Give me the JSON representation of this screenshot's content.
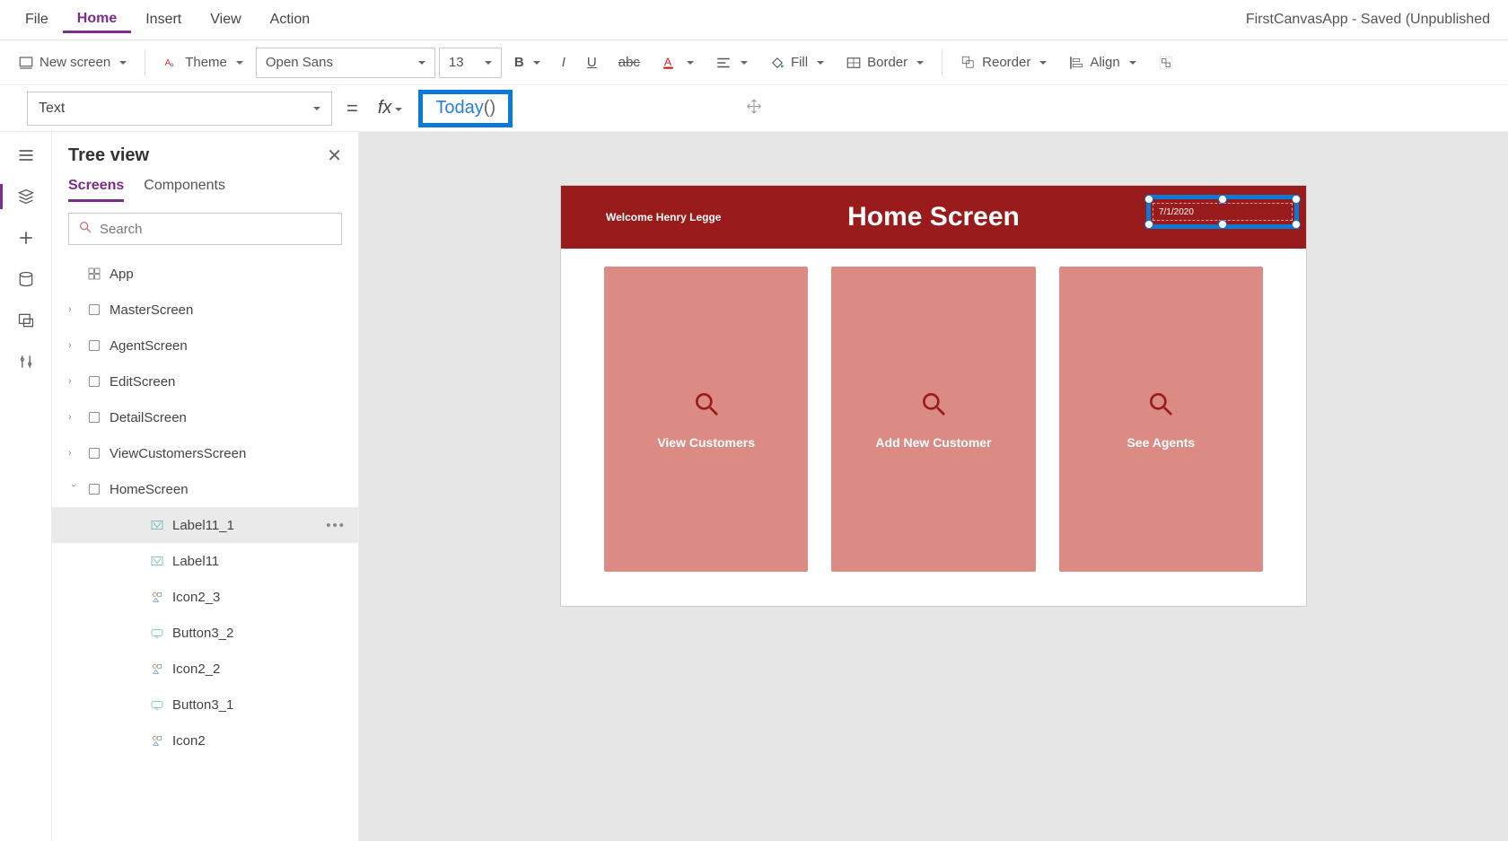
{
  "app_title": "FirstCanvasApp - Saved (Unpublished",
  "menubar": {
    "items": [
      "File",
      "Home",
      "Insert",
      "View",
      "Action"
    ],
    "active": "Home"
  },
  "ribbon": {
    "new_screen": "New screen",
    "theme": "Theme",
    "font_family": "Open Sans",
    "font_size": "13",
    "fill": "Fill",
    "border": "Border",
    "reorder": "Reorder",
    "align": "Align"
  },
  "formula": {
    "property": "Text",
    "fx": "fx",
    "value_fn": "Today",
    "value_rest": "()"
  },
  "tree": {
    "title": "Tree view",
    "tabs": {
      "screens": "Screens",
      "components": "Components",
      "active": "Screens"
    },
    "search_placeholder": "Search",
    "app_label": "App",
    "screens": [
      {
        "name": "MasterScreen"
      },
      {
        "name": "AgentScreen"
      },
      {
        "name": "EditScreen"
      },
      {
        "name": "DetailScreen"
      },
      {
        "name": "ViewCustomersScreen"
      },
      {
        "name": "HomeScreen",
        "expanded": true,
        "children": [
          {
            "name": "Label11_1",
            "icon": "label",
            "selected": true
          },
          {
            "name": "Label11",
            "icon": "label"
          },
          {
            "name": "Icon2_3",
            "icon": "icon"
          },
          {
            "name": "Button3_2",
            "icon": "button"
          },
          {
            "name": "Icon2_2",
            "icon": "icon"
          },
          {
            "name": "Button3_1",
            "icon": "button"
          },
          {
            "name": "Icon2",
            "icon": "icon"
          }
        ]
      }
    ]
  },
  "canvas": {
    "welcome": "Welcome Henry Legge",
    "title": "Home Screen",
    "date": "7/1/2020",
    "cards": [
      {
        "label": "View Customers"
      },
      {
        "label": "Add New Customer"
      },
      {
        "label": "See Agents"
      }
    ]
  }
}
